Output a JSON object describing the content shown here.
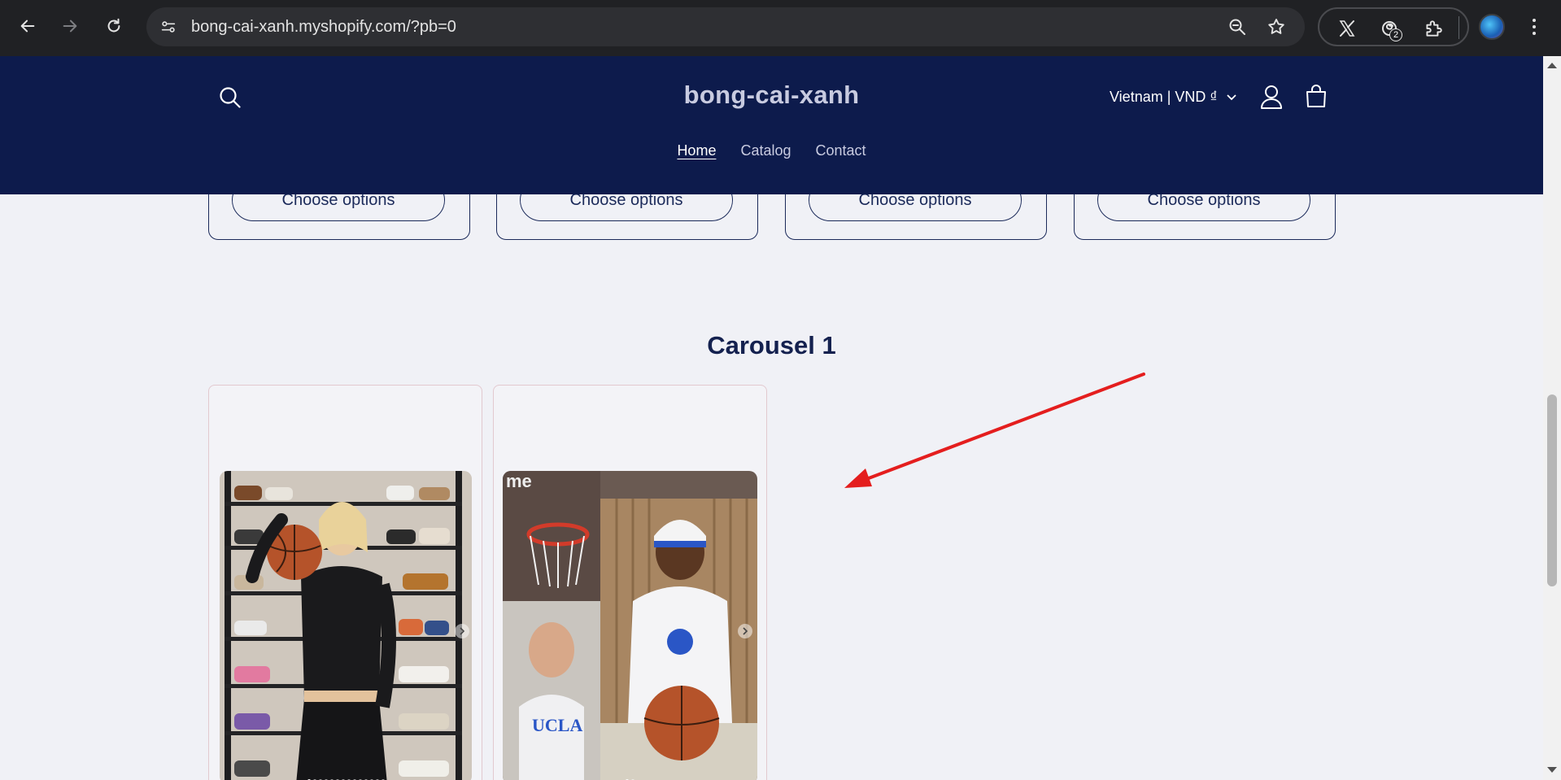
{
  "browser": {
    "url": "bong-cai-xanh.myshopify.com/?pb=0",
    "extension_badge": "2"
  },
  "store": {
    "brand": "bong-cai-xanh",
    "locale": "Vietnam | VND ₫",
    "nav": [
      {
        "label": "Home"
      },
      {
        "label": "Catalog"
      },
      {
        "label": "Contact"
      }
    ]
  },
  "products": [
    {
      "button_label": "Choose options"
    },
    {
      "button_label": "Choose options"
    },
    {
      "button_label": "Choose options"
    },
    {
      "button_label": "Choose options"
    }
  ],
  "carousel": {
    "title": "Carousel 1"
  },
  "colors": {
    "header_bg": "#0d1b4c",
    "page_bg": "#f0f1f6",
    "annotation_arrow": "#e41e1e"
  }
}
